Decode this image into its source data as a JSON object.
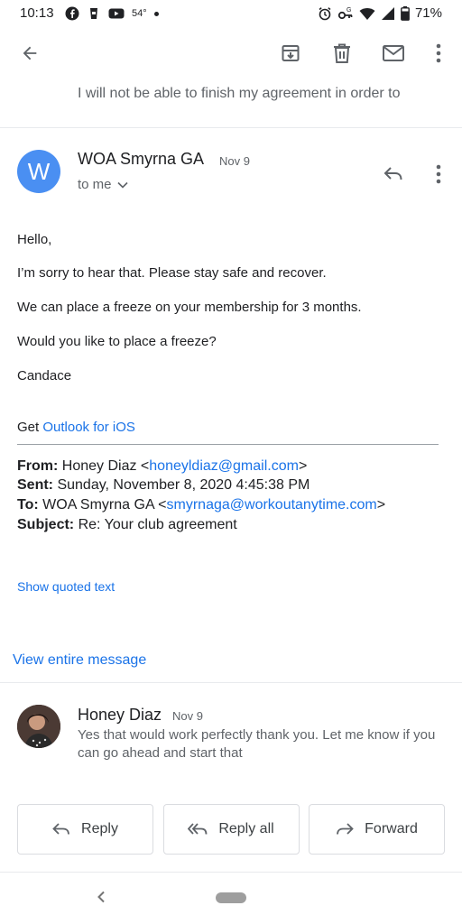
{
  "status_bar": {
    "time": "10:13",
    "temperature": "54°",
    "battery": "71%",
    "left_icons": [
      "facebook-icon",
      "cup-icon",
      "youtube-icon"
    ],
    "right_icons": [
      "alarm-icon",
      "vpn-key-icon",
      "wifi-icon",
      "signal-icon",
      "battery-icon"
    ]
  },
  "toolbar": {
    "icons": [
      "back-arrow-icon",
      "archive-icon",
      "delete-icon",
      "mark-unread-icon",
      "more-vert-icon"
    ]
  },
  "previous_message": {
    "snippet": "I will not be able to finish my agreement in order to"
  },
  "message": {
    "avatar_letter": "W",
    "avatar_color": "#4a8ff2",
    "sender": "WOA Smyrna GA",
    "date": "Nov 9",
    "recipient": "to me",
    "body": [
      "Hello,",
      "I’m sorry to hear that. Please stay safe and recover.",
      "We can place a freeze on your membership for 3 months.",
      "Would you like to place a freeze?",
      "Candace"
    ],
    "signature_prefix": "Get ",
    "signature_link": "Outlook for iOS",
    "forwarded": {
      "from_label": "From:",
      "from_name": "Honey Diaz <",
      "from_email": "honeyldiaz@gmail.com",
      "from_suffix": ">",
      "sent_label": "Sent:",
      "sent_value": "Sunday, November 8, 2020 4:45:38 PM",
      "to_label": "To:",
      "to_name": "WOA Smyrna GA <",
      "to_email": "smyrnaga@workoutanytime.com",
      "to_suffix": ">",
      "subject_label": "Subject:",
      "subject_value": "Re: Your club agreement"
    },
    "show_quoted": "Show quoted text",
    "view_entire": "View entire message"
  },
  "next_message": {
    "sender": "Honey Diaz",
    "date": "Nov 9",
    "snippet": "Yes that would work perfectly thank you. Let me know if you can go ahead and start that"
  },
  "actions": {
    "reply": "Reply",
    "reply_all": "Reply all",
    "forward": "Forward"
  },
  "colors": {
    "accent_link": "#1a73e8",
    "text_primary": "#202124",
    "text_secondary": "#5f6368"
  }
}
